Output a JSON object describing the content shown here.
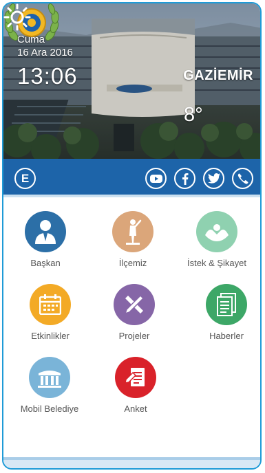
{
  "header": {
    "day": "Cuma",
    "date": "16 Ara 2016",
    "time": "13:06",
    "city": "GAZİEMİR",
    "temperature": "8°",
    "weather_icon": "sun-icon"
  },
  "social_bar": {
    "language_button": "E",
    "icons": [
      "youtube-icon",
      "facebook-icon",
      "twitter-icon",
      "phone-icon"
    ],
    "color": "#1d64a9"
  },
  "menu": {
    "items": [
      {
        "label": "Başkan",
        "icon": "person-icon",
        "color": "#2c6fa7"
      },
      {
        "label": "İlçemiz",
        "icon": "statue-icon",
        "color": "#dba67a"
      },
      {
        "label": "İstek & Şikayet",
        "icon": "hands-icon",
        "color": "#8fd1b0"
      },
      {
        "label": "Etkinlikler",
        "icon": "calendar-icon",
        "color": "#f3aa26"
      },
      {
        "label": "Projeler",
        "icon": "ruler-pencil-icon",
        "color": "#8666a7"
      },
      {
        "label": "Haberler",
        "icon": "document-icon",
        "color": "#3da767"
      },
      {
        "label": "Mobil Belediye",
        "icon": "building-icon",
        "color": "#7ab4d8"
      },
      {
        "label": "Anket",
        "icon": "survey-icon",
        "color": "#d9222a"
      }
    ]
  }
}
